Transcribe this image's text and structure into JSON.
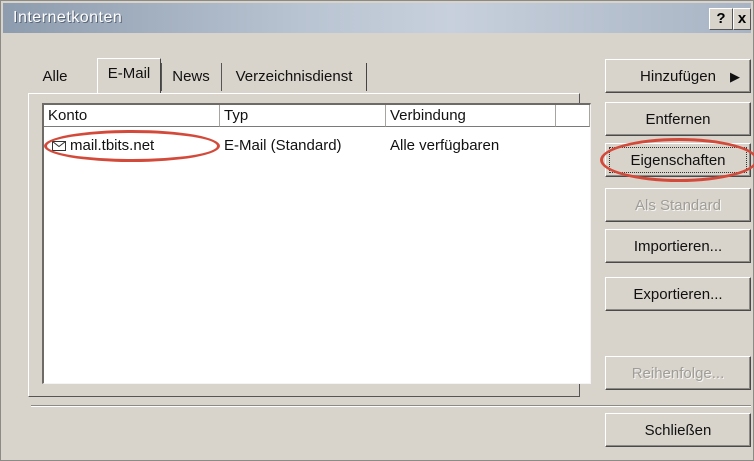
{
  "window": {
    "title": "Internetkonten"
  },
  "titlebar_buttons": {
    "help": "?",
    "close": "x"
  },
  "tabs": [
    {
      "label": "Alle"
    },
    {
      "label": "E-Mail"
    },
    {
      "label": "News"
    },
    {
      "label": "Verzeichnisdienst"
    }
  ],
  "active_tab": "E-Mail",
  "list": {
    "columns": [
      "Konto",
      "Typ",
      "Verbindung"
    ],
    "rows": [
      {
        "konto": "mail.tbits.net",
        "typ": "E-Mail (Standard)",
        "verbindung": "Alle verfügbaren",
        "icon": "mail-account-icon"
      }
    ]
  },
  "buttons": {
    "add": "Hinzufügen",
    "remove": "Entfernen",
    "properties": "Eigenschaften",
    "set_default": "Als Standard",
    "import": "Importieren...",
    "export": "Exportieren...",
    "order": "Reihenfolge...",
    "close": "Schließen"
  },
  "colors": {
    "dialog_bg": "#d8d4cb",
    "highlight_oval": "#d44a3a"
  }
}
